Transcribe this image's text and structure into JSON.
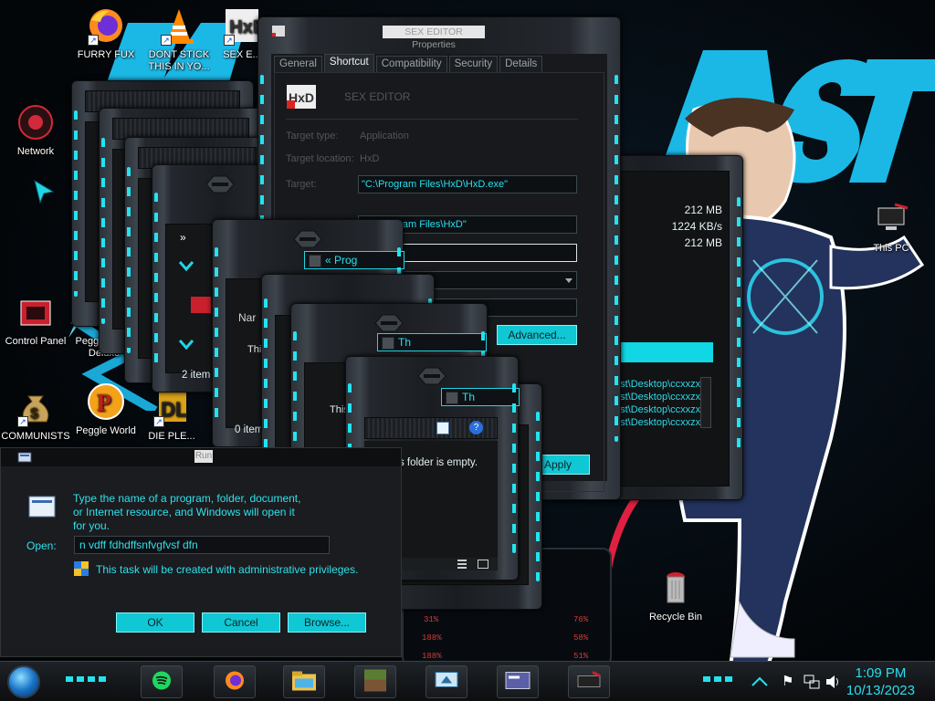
{
  "desktop": {
    "icons": [
      {
        "label": "FURRY FUX",
        "icon": "firefox-icon"
      },
      {
        "label": "DONT STICK THIS IN YO...",
        "icon": "vlc-cone-icon"
      },
      {
        "label": "SEX E...",
        "icon": "hxd-icon"
      },
      {
        "label": "Network",
        "icon": "network-icon"
      },
      {
        "label": "Control Panel",
        "icon": "control-panel-icon"
      },
      {
        "label": "Peggle Nig... Deluxe",
        "icon": "peggle-nights-icon"
      },
      {
        "label": "COMMUNISTS",
        "icon": "money-bag-icon"
      },
      {
        "label": "Peggle World",
        "icon": "peggle-world-icon"
      },
      {
        "label": "DIE PLE...",
        "icon": "die-icon"
      },
      {
        "label": "This PC",
        "icon": "this-pc-icon"
      },
      {
        "label": "Recycle Bin",
        "icon": "recycle-bin-icon"
      }
    ]
  },
  "properties_window": {
    "title": "SEX EDITOR Properties",
    "tabs": [
      "General",
      "Shortcut",
      "Compatibility",
      "Security",
      "Details"
    ],
    "active_tab": "Shortcut",
    "app_name": "SEX EDITOR",
    "target_type_label": "Target type:",
    "target_type_value": "Application",
    "target_location_label": "Target location:",
    "target_location_value": "HxD",
    "target_label": "Target:",
    "target_value": "\"C:\\Program Files\\HxD\\HxD.exe\"",
    "start_in_value": "\"C:\\Program Files\\HxD\"",
    "advanced_button": "Advanced...",
    "apply_button": "Apply"
  },
  "stats_window": {
    "values": [
      "212 MB",
      "1224 KB/s",
      "212 MB"
    ],
    "list": [
      "ast\\Desktop\\ccxxzx",
      "ast\\Desktop\\ccxxzx",
      "ast\\Desktop\\ccxxzx",
      "ast\\Desktop\\ccxxzx"
    ]
  },
  "explorer_windows": {
    "addr_programs": "« Prog",
    "addr_this": "Th",
    "addr_this2": "This",
    "col_name": "Nar",
    "items_2": "2 item",
    "items_0": "0 item",
    "text_this": "This",
    "empty_message": "This folder is empty.",
    "nav_fwd": "»"
  },
  "run_dialog": {
    "title": "Run",
    "description": "Type the name of a program, folder, document, or Internet resource, and Windows will open it for you.",
    "open_label": "Open:",
    "open_value": "n  vdff fdhdffsnfvgfvsf dfn",
    "admin_note": "This task will be created with administrative privileges.",
    "ok": "OK",
    "cancel": "Cancel",
    "browse": "Browse..."
  },
  "hud": {
    "readouts": [
      "31%",
      "76%",
      "188%",
      "58%",
      "188%",
      "51%"
    ]
  },
  "taskbar": {
    "time": "1:09 PM",
    "date": "10/13/2023",
    "apps": [
      "spotify-icon",
      "firefox-icon",
      "file-explorer-icon",
      "minecraft-icon",
      "remote-desktop-icon",
      "card-icon",
      "flag-app-icon"
    ]
  },
  "colors": {
    "accent": "#23e3f0",
    "frame": "#2c3138",
    "panel": "#141618"
  }
}
